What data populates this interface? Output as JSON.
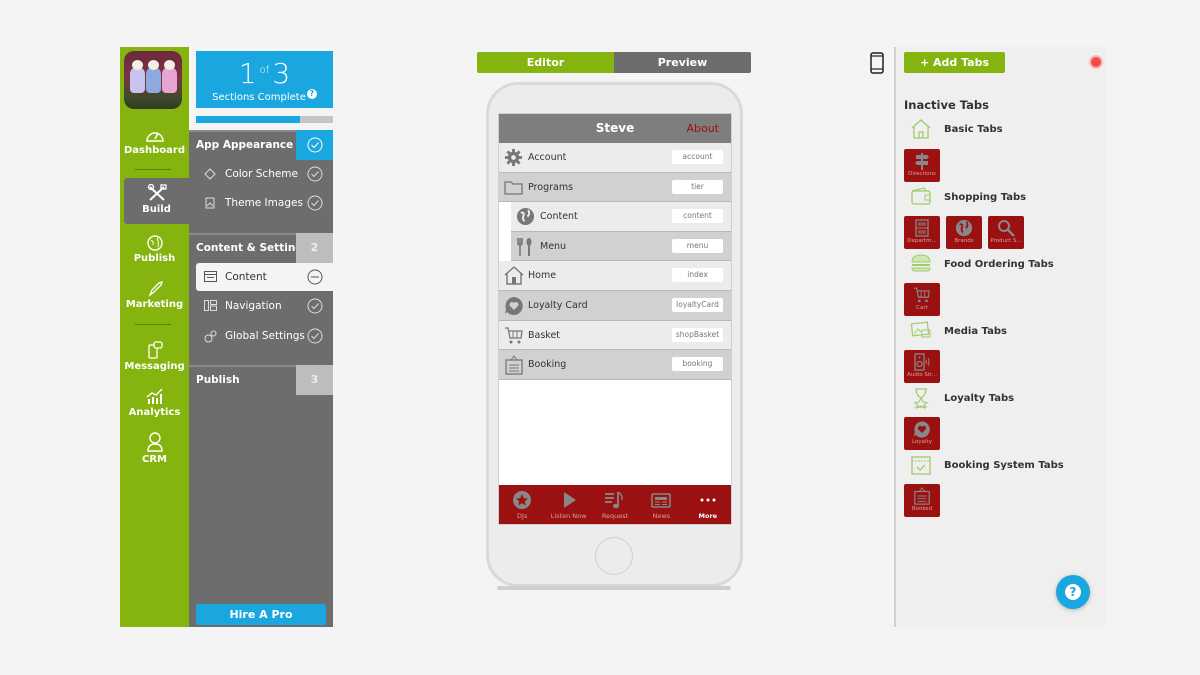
{
  "sidebar": {
    "items": [
      {
        "label": "Dashboard",
        "icon": "gauge-icon"
      },
      {
        "label": "Build",
        "icon": "tools-icon",
        "active": true
      },
      {
        "label": "Publish",
        "icon": "globe-icon"
      },
      {
        "label": "Marketing",
        "icon": "rocket-icon"
      },
      {
        "label": "Messaging",
        "icon": "phone-chat-icon"
      },
      {
        "label": "Analytics",
        "icon": "chart-icon"
      },
      {
        "label": "CRM",
        "icon": "person-icon"
      }
    ]
  },
  "progress": {
    "current": "1",
    "of": "of",
    "total": "3",
    "label": "Sections Complete",
    "help": "?",
    "fill_fraction": 0.76
  },
  "sections": [
    {
      "title": "App Appearance",
      "badge": "✓",
      "steps": [
        {
          "label": "Color Scheme",
          "icon": "paint-bucket-icon",
          "state": "done"
        },
        {
          "label": "Theme Images",
          "icon": "image-icon",
          "state": "done"
        }
      ]
    },
    {
      "title": "Content & Settings",
      "badge": "2",
      "steps": [
        {
          "label": "Content",
          "icon": "content-icon",
          "state": "in-progress"
        },
        {
          "label": "Navigation",
          "icon": "navigation-icon",
          "state": "done"
        },
        {
          "label": "Global Settings",
          "icon": "gears-icon",
          "state": "done"
        }
      ]
    },
    {
      "title": "Publish",
      "badge": "3",
      "steps": []
    }
  ],
  "hire_pro": "Hire A Pro",
  "mode_toggle": {
    "editor": "Editor",
    "preview": "Preview",
    "active": "Editor"
  },
  "phone": {
    "title": "Steve",
    "about": "About",
    "rows": [
      {
        "label": "Account",
        "key": "account",
        "icon": "gear-icon"
      },
      {
        "label": "Programs",
        "key": "tier",
        "icon": "folder-icon"
      },
      {
        "label": "Content",
        "key": "content",
        "icon": "globe-icon",
        "sub": true
      },
      {
        "label": "Menu",
        "key": "menu",
        "icon": "fork-knife-icon",
        "sub": true
      },
      {
        "label": "Home",
        "key": "index",
        "icon": "home-icon"
      },
      {
        "label": "Loyalty Card",
        "key": "loyaltyCard",
        "icon": "heart-bubble-icon"
      },
      {
        "label": "Basket",
        "key": "shopBasket",
        "icon": "cart-icon"
      },
      {
        "label": "Booking",
        "key": "booking",
        "icon": "booking-sign-icon"
      }
    ],
    "tabs": [
      {
        "label": "DJs",
        "icon": "star-circle-icon"
      },
      {
        "label": "Listen Now",
        "icon": "play-icon"
      },
      {
        "label": "Request",
        "icon": "music-list-icon"
      },
      {
        "label": "News",
        "icon": "newspaper-icon"
      },
      {
        "label": "More",
        "icon": "ellipsis-icon"
      }
    ]
  },
  "right_panel": {
    "add_tabs": "+ Add Tabs",
    "inactive_title": "Inactive Tabs",
    "categories": [
      {
        "label": "Basic Tabs",
        "icon": "home-outline-icon",
        "tiles": [
          {
            "label": "Directions",
            "icon": "signpost-icon"
          }
        ]
      },
      {
        "label": "Shopping Tabs",
        "icon": "wallet-icon",
        "tiles": [
          {
            "label": "Departm...",
            "icon": "cabinet-icon"
          },
          {
            "label": "Brands",
            "icon": "globe-icon"
          },
          {
            "label": "Product S...",
            "icon": "search-icon"
          }
        ]
      },
      {
        "label": "Food Ordering Tabs",
        "icon": "burger-icon",
        "tiles": [
          {
            "label": "Cart",
            "icon": "cart-icon"
          }
        ]
      },
      {
        "label": "Media Tabs",
        "icon": "media-icon",
        "tiles": [
          {
            "label": "Audio Str...",
            "icon": "speaker-icon"
          }
        ]
      },
      {
        "label": "Loyalty Tabs",
        "icon": "hourglass-star-icon",
        "tiles": [
          {
            "label": "Loyalty",
            "icon": "heart-bubble-icon"
          }
        ]
      },
      {
        "label": "Booking System Tabs",
        "icon": "calendar-check-icon",
        "tiles": [
          {
            "label": "Booked",
            "icon": "booking-sign-icon"
          }
        ]
      }
    ]
  },
  "help_button": "?",
  "colors": {
    "brand_green": "#86b40e",
    "accent_blue": "#1aa7e0",
    "tab_red": "#9b1010",
    "panel_gray": "#6d6d6d"
  }
}
